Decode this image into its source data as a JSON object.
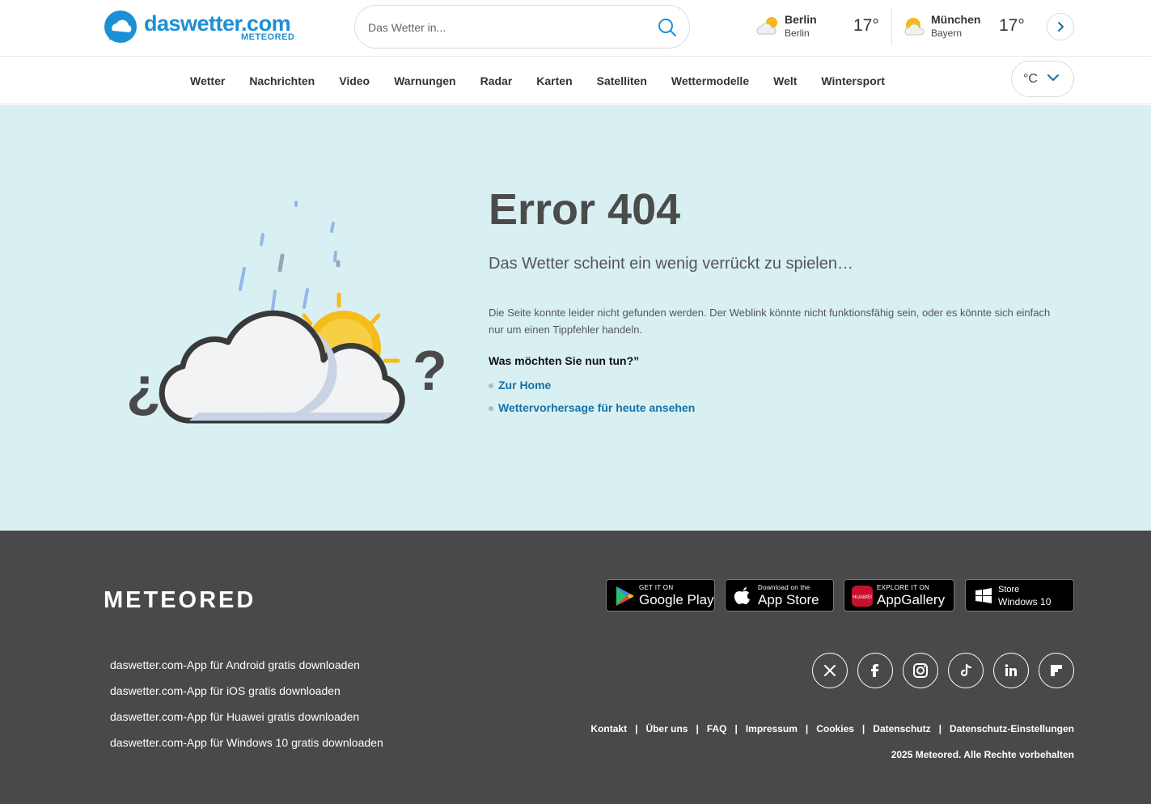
{
  "header": {
    "brand": "daswetter.com",
    "brand_sub": "METEORED",
    "search_placeholder": "Das Wetter in...",
    "cities": [
      {
        "name": "Berlin",
        "region": "Berlin",
        "temp": "17°",
        "icon": "partly-cloudy-icon"
      },
      {
        "name": "München",
        "region": "Bayern",
        "temp": "17°",
        "icon": "partly-cloudy-icon"
      }
    ]
  },
  "nav": {
    "items": [
      "Wetter",
      "Nachrichten",
      "Video",
      "Warnungen",
      "Radar",
      "Karten",
      "Satelliten",
      "Wettermodelle",
      "Welt",
      "Wintersport"
    ],
    "unit": "°C"
  },
  "main": {
    "title": "Error 404",
    "subtitle": "Das Wetter scheint ein wenig verrückt zu spielen…",
    "description": "Die Seite konnte leider nicht gefunden werden. Der Weblink könnte nicht funktionsfähig sein, oder es könnte sich einfach nur um einen Tippfehler handeln.",
    "question": "Was möchten Sie nun tun?”",
    "links": [
      "Zur Home",
      "Wettervorhersage für heute ansehen"
    ]
  },
  "footer": {
    "logo": "METEORED",
    "stores": [
      {
        "small": "GET IT ON",
        "big": "Google Play"
      },
      {
        "small": "Download on the",
        "big": "App Store"
      },
      {
        "small": "EXPLORE IT ON",
        "big": "AppGallery"
      },
      {
        "small": "Store",
        "big": "Windows 10"
      }
    ],
    "downloads": [
      "daswetter.com-App für Android gratis downloaden",
      "daswetter.com-App für iOS gratis downloaden",
      "daswetter.com-App für Huawei gratis downloaden",
      "daswetter.com-App für Windows 10 gratis downloaden"
    ],
    "social": [
      "x-icon",
      "facebook-icon",
      "instagram-icon",
      "tiktok-icon",
      "linkedin-icon",
      "flipboard-icon"
    ],
    "links": [
      "Kontakt",
      "Über uns",
      "FAQ",
      "Impressum",
      "Cookies",
      "Datenschutz",
      "Datenschutz-Einstellungen"
    ],
    "copyright": "2025 Meteored. Alle Rechte vorbehalten"
  },
  "colors": {
    "brand": "#1d8fd6",
    "main_bg": "#d9f0f2",
    "footer_bg": "#49484a",
    "link": "#1571a8"
  }
}
